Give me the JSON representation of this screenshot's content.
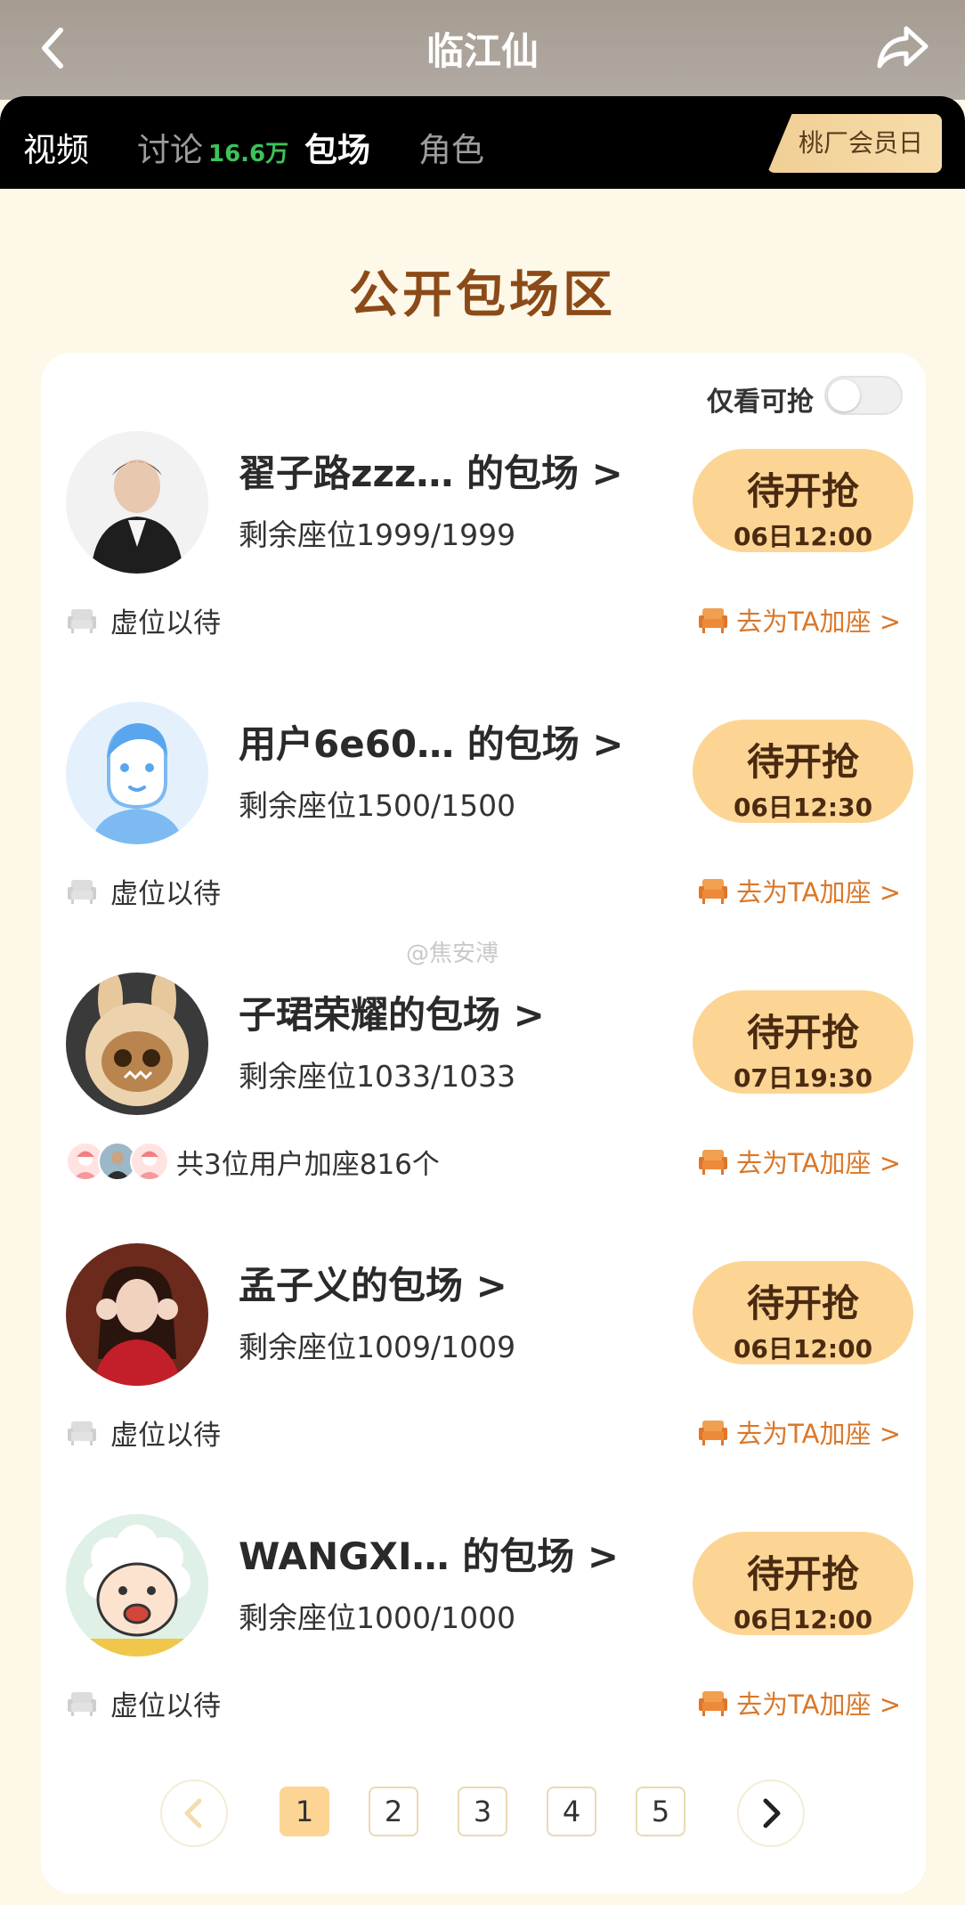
{
  "header": {
    "title": "临江仙"
  },
  "tabs": [
    {
      "label": "视频",
      "count": ""
    },
    {
      "label": "讨论",
      "count": "16.6万"
    },
    {
      "label": "包场",
      "count": ""
    },
    {
      "label": "角色",
      "count": ""
    }
  ],
  "member_day_label": "桃厂会员日",
  "section_title": "公开包场区",
  "filter": {
    "label": "仅看可抢",
    "on": false
  },
  "items": [
    {
      "owner": "翟子路zzz… 的包场 >",
      "seats": "剩余座位1999/1999",
      "button": "待开抢",
      "time": "06日12:00",
      "note": "虚位以待",
      "join": "去为TA加座 >"
    },
    {
      "owner": "用户6e60… 的包场 >",
      "seats": "剩余座位1500/1500",
      "button": "待开抢",
      "time": "06日12:30",
      "note": "虚位以待",
      "join": "去为TA加座 >"
    },
    {
      "owner": "子珺荣耀的包场 >",
      "seats": "剩余座位1033/1033",
      "button": "待开抢",
      "time": "07日19:30",
      "note": "共3位用户加座816个",
      "join": "去为TA加座 >"
    },
    {
      "owner": "孟子义的包场 >",
      "seats": "剩余座位1009/1009",
      "button": "待开抢",
      "time": "06日12:00",
      "note": "虚位以待",
      "join": "去为TA加座 >"
    },
    {
      "owner": "WANGXI… 的包场 >",
      "seats": "剩余座位1000/1000",
      "button": "待开抢",
      "time": "06日12:00",
      "note": "虚位以待",
      "join": "去为TA加座 >"
    }
  ],
  "pagination": {
    "pages": [
      "1",
      "2",
      "3",
      "4",
      "5"
    ],
    "current": "1"
  },
  "watermark": "@焦安溥",
  "icons": {
    "back": "chevron-left-icon",
    "share": "share-arrow-icon",
    "seat": "sofa-icon"
  },
  "colors": {
    "accent": "#fcd594",
    "section_title": "#8c4a18",
    "join_link": "#d9782a",
    "count_green": "#3cc35a"
  }
}
